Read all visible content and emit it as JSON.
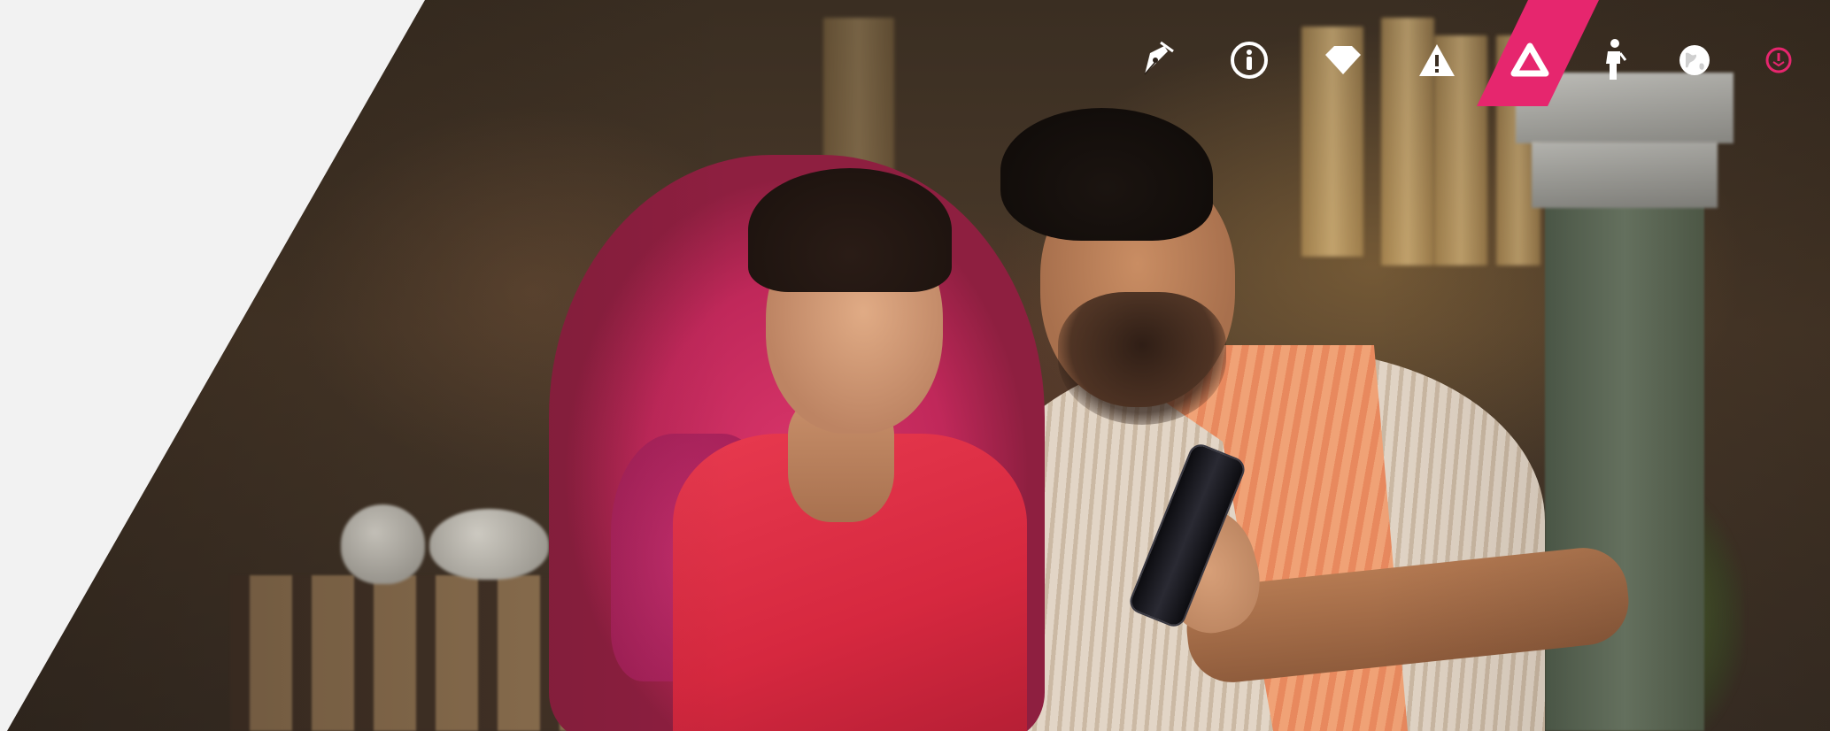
{
  "colors": {
    "accent": "#e6266e",
    "icon": "#ffffff",
    "panel": "#f2f2f2"
  },
  "nav": {
    "items": [
      {
        "icon": "pen-nib-icon"
      },
      {
        "icon": "info-circle-icon"
      },
      {
        "icon": "diamond-icon"
      },
      {
        "icon": "warning-triangle-icon"
      },
      {
        "icon": "triangle-outline-icon",
        "active": true
      },
      {
        "icon": "person-standing-icon"
      },
      {
        "icon": "globe-icon"
      },
      {
        "icon": "power-icon"
      }
    ]
  },
  "hero": {
    "image": "photo-couple-smiling-at-phone"
  }
}
